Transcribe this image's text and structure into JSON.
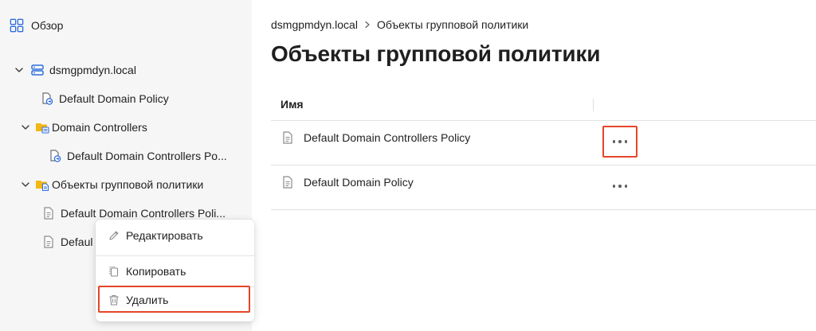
{
  "sidebar": {
    "overview_label": "Обзор",
    "tree": [
      {
        "label": "dsmgpmdyn.local",
        "icon": "domain-icon",
        "expanded": true
      },
      {
        "label": "Default Domain Policy",
        "icon": "gpo-link-icon"
      },
      {
        "label": "Domain Controllers",
        "icon": "ou-folder-icon",
        "expanded": true
      },
      {
        "label": "Default Domain Controllers Po...",
        "icon": "gpo-link-icon"
      },
      {
        "label": "Объекты групповой политики",
        "icon": "gpo-folder-icon",
        "expanded": true
      },
      {
        "label": "Default Domain Controllers Poli...",
        "icon": "document-icon"
      },
      {
        "label": "Defaul",
        "icon": "document-icon"
      }
    ]
  },
  "context_menu": {
    "edit_label": "Редактировать",
    "copy_label": "Копировать",
    "delete_label": "Удалить"
  },
  "main": {
    "breadcrumb": {
      "root": "dsmgpmdyn.local",
      "current": "Объекты групповой политики"
    },
    "title": "Объекты групповой политики",
    "table": {
      "columns": [
        "Имя"
      ],
      "rows": [
        {
          "name": "Default Domain Controllers Policy"
        },
        {
          "name": "Default Domain Policy"
        }
      ]
    }
  },
  "colors": {
    "accent_blue": "#2f6fdb",
    "folder_yellow": "#f2b713",
    "highlight_red": "#e5452a",
    "sidebar_bg": "#f6f6f7"
  }
}
